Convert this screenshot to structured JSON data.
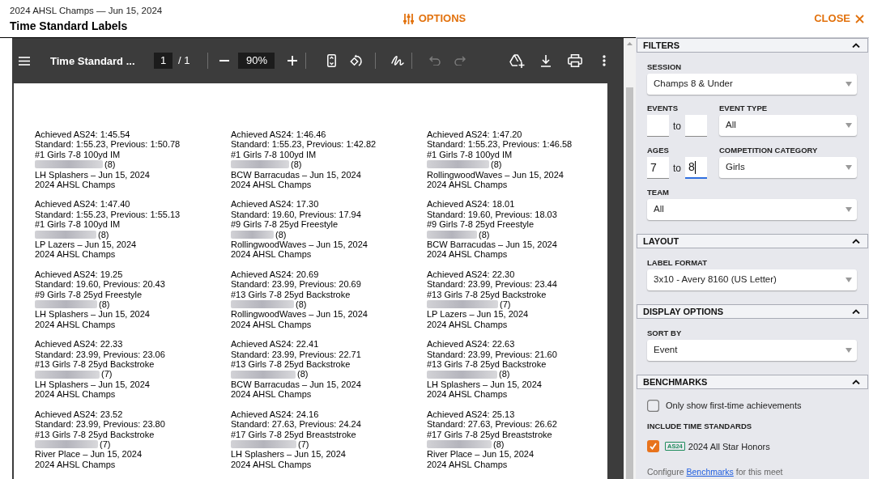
{
  "header": {
    "subtitle": "2024 AHSL Champs — Jun 15, 2024",
    "title": "Time Standard Labels",
    "options_button": "OPTIONS",
    "close_button": "CLOSE"
  },
  "pdf_viewer": {
    "toolbar": {
      "document_title": "Time Standard ...",
      "page_number": "1",
      "page_total": "/ 1",
      "zoom": "90%",
      "undo": {
        "disabled": true
      },
      "redo": {
        "disabled": true
      }
    },
    "labels": [
      {
        "achieved": "Achieved AS24: 1:45.54",
        "standard": "Standard: 1:55.23, Previous: 1:50.78",
        "event": "#1 Girls 7-8 100yd IM",
        "age": "(8)",
        "team_date": "LH Splashers – Jun 15, 2024",
        "meet": "2024 AHSL Champs"
      },
      {
        "achieved": "Achieved AS24: 1:46.46",
        "standard": "Standard: 1:55.23, Previous: 1:42.82",
        "event": "#1 Girls 7-8 100yd IM",
        "age": "(8)",
        "team_date": "BCW Barracudas – Jun 15, 2024",
        "meet": "2024 AHSL Champs"
      },
      {
        "achieved": "Achieved AS24: 1:47.20",
        "standard": "Standard: 1:55.23, Previous: 1:46.58",
        "event": "#1 Girls 7-8 100yd IM",
        "age": "(8)",
        "team_date": "RollingwoodWaves – Jun 15, 2024",
        "meet": "2024 AHSL Champs"
      },
      {
        "achieved": "Achieved AS24: 1:47.40",
        "standard": "Standard: 1:55.23, Previous: 1:55.13",
        "event": "#1 Girls 7-8 100yd IM",
        "age": "(8)",
        "team_date": "LP Lazers – Jun 15, 2024",
        "meet": "2024 AHSL Champs"
      },
      {
        "achieved": "Achieved AS24: 17.30",
        "standard": "Standard: 19.60, Previous: 17.94",
        "event": "#9 Girls 7-8 25yd Freestyle",
        "age": "(8)",
        "team_date": "RollingwoodWaves – Jun 15, 2024",
        "meet": "2024 AHSL Champs"
      },
      {
        "achieved": "Achieved AS24: 18.01",
        "standard": "Standard: 19.60, Previous: 18.03",
        "event": "#9 Girls 7-8 25yd Freestyle",
        "age": "(8)",
        "team_date": "BCW Barracudas – Jun 15, 2024",
        "meet": "2024 AHSL Champs"
      },
      {
        "achieved": "Achieved AS24: 19.25",
        "standard": "Standard: 19.60, Previous: 20.43",
        "event": "#9 Girls 7-8 25yd Freestyle",
        "age": "(8)",
        "team_date": "LH Splashers – Jun 15, 2024",
        "meet": "2024 AHSL Champs"
      },
      {
        "achieved": "Achieved AS24: 20.69",
        "standard": "Standard: 23.99, Previous: 20.69",
        "event": "#13 Girls 7-8 25yd Backstroke",
        "age": "(8)",
        "team_date": "RollingwoodWaves – Jun 15, 2024",
        "meet": "2024 AHSL Champs"
      },
      {
        "achieved": "Achieved AS24: 22.30",
        "standard": "Standard: 23.99, Previous: 23.44",
        "event": "#13 Girls 7-8 25yd Backstroke",
        "age": "(7)",
        "team_date": "LP Lazers – Jun 15, 2024",
        "meet": "2024 AHSL Champs"
      },
      {
        "achieved": "Achieved AS24: 22.33",
        "standard": "Standard: 23.99, Previous: 23.06",
        "event": "#13 Girls 7-8 25yd Backstroke",
        "age": "(7)",
        "team_date": "LH Splashers – Jun 15, 2024",
        "meet": "2024 AHSL Champs"
      },
      {
        "achieved": "Achieved AS24: 22.41",
        "standard": "Standard: 23.99, Previous: 22.71",
        "event": "#13 Girls 7-8 25yd Backstroke",
        "age": "(8)",
        "team_date": "BCW Barracudas – Jun 15, 2024",
        "meet": "2024 AHSL Champs"
      },
      {
        "achieved": "Achieved AS24: 22.63",
        "standard": "Standard: 23.99, Previous: 21.60",
        "event": "#13 Girls 7-8 25yd Backstroke",
        "age": "(8)",
        "team_date": "LH Splashers – Jun 15, 2024",
        "meet": "2024 AHSL Champs"
      },
      {
        "achieved": "Achieved AS24: 23.52",
        "standard": "Standard: 23.99, Previous: 23.80",
        "event": "#13 Girls 7-8 25yd Backstroke",
        "age": "(7)",
        "team_date": "River Place – Jun 15, 2024",
        "meet": "2024 AHSL Champs"
      },
      {
        "achieved": "Achieved AS24: 24.16",
        "standard": "Standard: 27.63, Previous: 24.24",
        "event": "#17 Girls 7-8 25yd Breaststroke",
        "age": "(7)",
        "team_date": "LH Splashers – Jun 15, 2024",
        "meet": "2024 AHSL Champs"
      },
      {
        "achieved": "Achieved AS24: 25.13",
        "standard": "Standard: 27.63, Previous: 26.62",
        "event": "#17 Girls 7-8 25yd Breaststroke",
        "age": "(8)",
        "team_date": "River Place – Jun 15, 2024",
        "meet": "2024 AHSL Champs"
      }
    ]
  },
  "sidebar": {
    "sections": [
      {
        "title": "FILTERS",
        "expanded": true,
        "rows": [
          [
            {
              "kind": "select",
              "label": "SESSION",
              "value": "Champs 8 & Under"
            }
          ],
          [
            {
              "kind": "range",
              "label": "EVENTS",
              "separator": "to",
              "inputs": [
                {
                  "focused": false
                },
                {
                  "focused": false
                }
              ]
            },
            {
              "kind": "select",
              "label": "EVENT TYPE",
              "value": "All"
            }
          ],
          [
            {
              "kind": "range",
              "label": "AGES",
              "separator": "to",
              "inputs": [
                {
                  "value": "7",
                  "focused": false
                },
                {
                  "value": "8",
                  "focused": true
                }
              ]
            },
            {
              "kind": "select",
              "label": "COMPETITION CATEGORY",
              "value": "Girls"
            }
          ],
          [
            {
              "kind": "select",
              "label": "TEAM",
              "value": "All"
            }
          ]
        ]
      },
      {
        "title": "LAYOUT",
        "expanded": true,
        "rows": [
          [
            {
              "kind": "select",
              "label": "LABEL FORMAT",
              "value": "3x10 - Avery 8160 (US Letter)"
            }
          ]
        ]
      },
      {
        "title": "DISPLAY OPTIONS",
        "expanded": true,
        "rows": [
          [
            {
              "kind": "select",
              "label": "SORT BY",
              "value": "Event"
            }
          ]
        ]
      },
      {
        "title": "BENCHMARKS",
        "expanded": true,
        "rows": [
          [
            {
              "kind": "checkbox",
              "label": "Only show first-time achievements",
              "checked": false
            }
          ],
          [
            {
              "kind": "heading",
              "label": "INCLUDE TIME STANDARDS"
            }
          ],
          [
            {
              "kind": "standard",
              "badge": "AS24",
              "label": "2024 All Star Honors",
              "checked": true
            }
          ],
          [
            {
              "kind": "note",
              "text_before": "Configure ",
              "link": "Benchmarks",
              "text_after": " for this meet"
            }
          ]
        ]
      }
    ]
  }
}
